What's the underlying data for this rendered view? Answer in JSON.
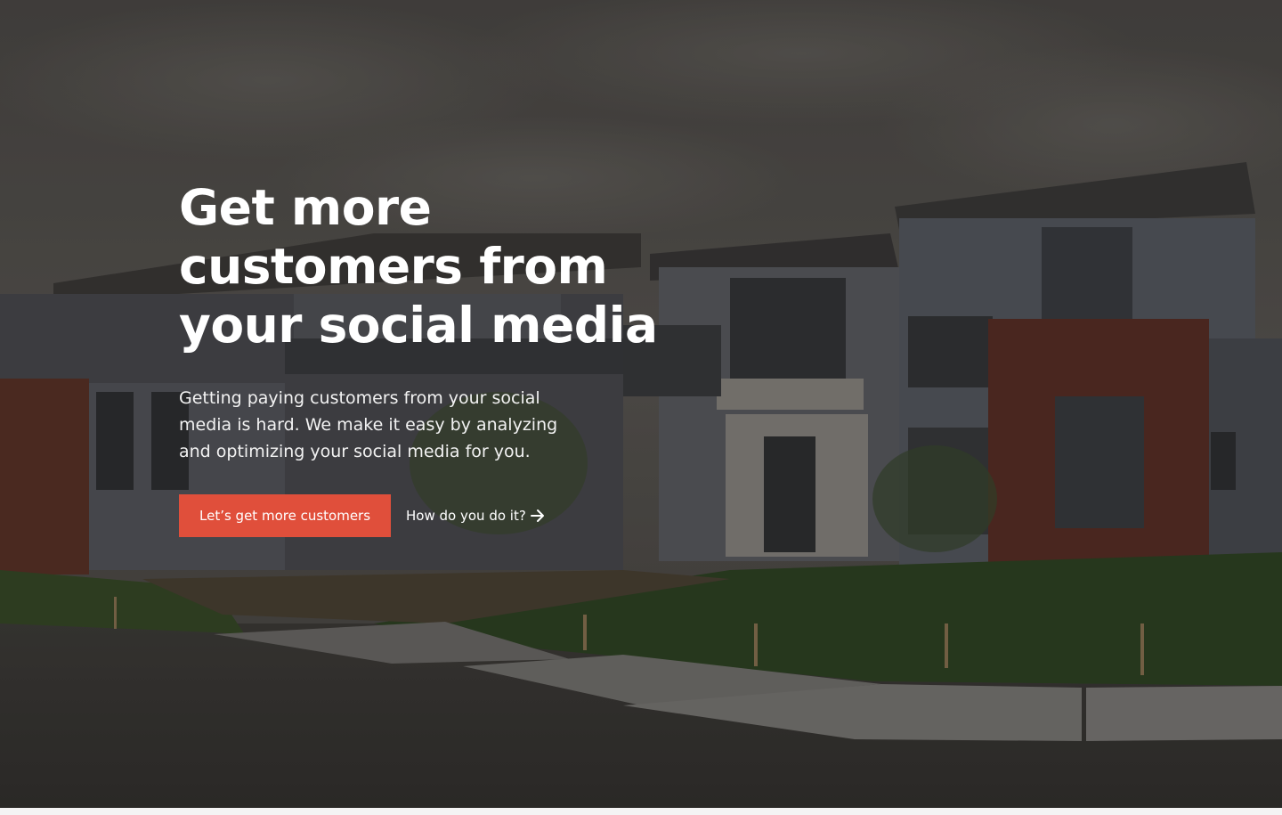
{
  "hero": {
    "title": "Get more customers from your social media",
    "subtitle": "Getting paying customers from your social media is hard. We make it easy by analyzing and optimizing your social media for you.",
    "primary_cta_label": "Let’s get more customers",
    "secondary_cta_label": "How do you do it?",
    "secondary_cta_icon": "arrow-right-icon",
    "background_image": "modern-house-photo",
    "colors": {
      "accent": "#e04f3b",
      "text": "#ffffff"
    }
  }
}
